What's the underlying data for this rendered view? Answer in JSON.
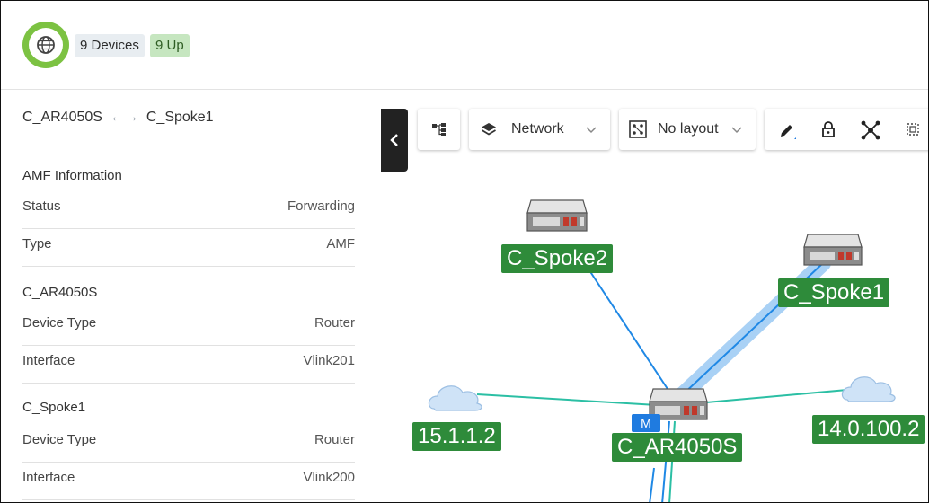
{
  "header": {
    "devices_badge": "9 Devices",
    "up_badge": "9 Up"
  },
  "panel": {
    "link_from": "C_AR4050S",
    "link_arrow": "←→",
    "link_to": "C_Spoke1",
    "sections": [
      {
        "title": "AMF Information",
        "rows": [
          {
            "key": "Status",
            "value": "Forwarding"
          },
          {
            "key": "Type",
            "value": "AMF"
          }
        ]
      },
      {
        "title": "C_AR4050S",
        "rows": [
          {
            "key": "Device Type",
            "value": "Router"
          },
          {
            "key": "Interface",
            "value": "Vlink201"
          }
        ]
      },
      {
        "title": "C_Spoke1",
        "rows": [
          {
            "key": "Device Type",
            "value": "Router"
          },
          {
            "key": "Interface",
            "value": "Vlink200"
          }
        ]
      }
    ]
  },
  "toolbar": {
    "view_select": "Network",
    "layout_select": "No layout"
  },
  "topology": {
    "nodes": {
      "spoke2": "C_Spoke2",
      "spoke1": "C_Spoke1",
      "core": "C_AR4050S",
      "cloud_left": "15.1.1.2",
      "cloud_right": "14.0.100.2"
    },
    "master_badge": "M"
  },
  "colors": {
    "accent_green": "#7cc242",
    "node_label_green": "#2e8b3a",
    "link_blue": "#1f88e5",
    "link_teal": "#2bbfa4",
    "highlight_blue": "#a9d1f5"
  }
}
